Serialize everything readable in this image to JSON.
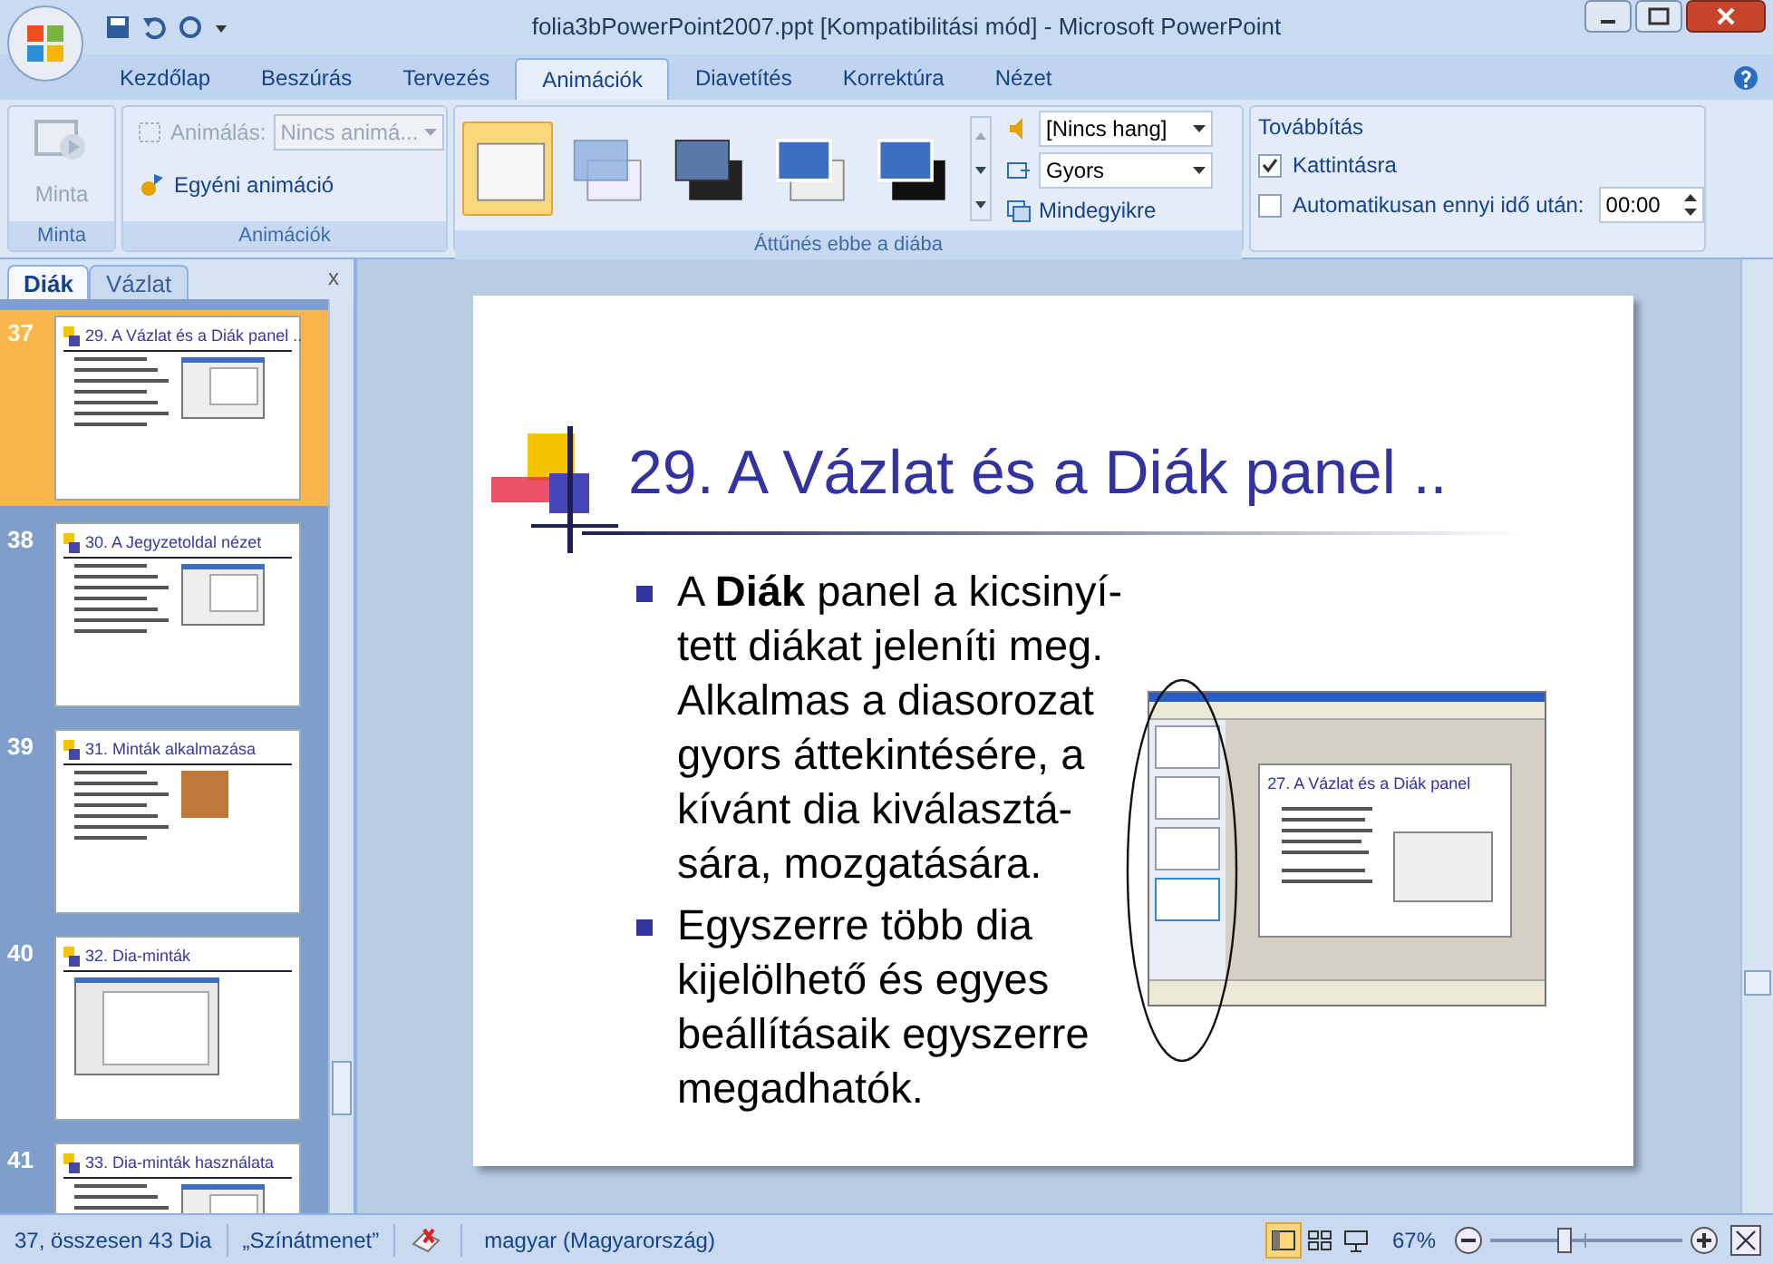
{
  "window": {
    "title": "folia3bPowerPoint2007.ppt [Kompatibilitási mód] - Microsoft PowerPoint"
  },
  "ribbon": {
    "tabs": [
      {
        "label": "Kezdőlap",
        "selected": false
      },
      {
        "label": "Beszúrás",
        "selected": false
      },
      {
        "label": "Tervezés",
        "selected": false
      },
      {
        "label": "Animációk",
        "selected": true
      },
      {
        "label": "Diavetítés",
        "selected": false
      },
      {
        "label": "Korrektúra",
        "selected": false
      },
      {
        "label": "Nézet",
        "selected": false
      }
    ],
    "preview": {
      "label": "Minta",
      "disabled": true,
      "group": "Minta"
    },
    "animations": {
      "label": "Animálás:",
      "value": "Nincs animá...",
      "disabled": true,
      "custom": "Egyéni animáció",
      "group": "Animációk"
    },
    "transitions": {
      "gallery": [
        {
          "selected": true
        },
        {
          "selected": false
        },
        {
          "selected": false
        },
        {
          "selected": false
        },
        {
          "selected": false
        }
      ],
      "sound": "[Nincs hang]",
      "speed": "Gyors",
      "apply_all": "Mindegyikre",
      "group": "Áttűnés ebbe a diába"
    },
    "advance": {
      "title": "Továbbítás",
      "options": [
        {
          "label": "Kattintásra",
          "checked": true
        },
        {
          "label": "Automatikusan ennyi idő után:",
          "checked": false
        }
      ],
      "time": "00:00"
    }
  },
  "panel": {
    "tabs": [
      {
        "label": "Diák",
        "selected": true
      },
      {
        "label": "Vázlat",
        "selected": false
      }
    ],
    "close": "x",
    "slides": [
      {
        "number": "37",
        "title": "29. A Vázlat és a Diák panel ..",
        "selected": true,
        "kind": "text-image"
      },
      {
        "number": "38",
        "title": "30. A Jegyzetoldal nézet",
        "selected": false,
        "kind": "text-image"
      },
      {
        "number": "39",
        "title": "31. Minták alkalmazása",
        "selected": false,
        "kind": "text-photo"
      },
      {
        "number": "40",
        "title": "32. Dia-minták",
        "selected": false,
        "kind": "image"
      },
      {
        "number": "41",
        "title": "33. Dia-minták használata",
        "selected": false,
        "kind": "text-image"
      }
    ]
  },
  "slide": {
    "title": "29. A Vázlat és a Diák panel ..",
    "bullets": [
      {
        "lines": [
          "A **Diák** panel a kicsinyí-",
          "tett diákat jeleníti meg.",
          "Alkalmas a diasorozat",
          "gyors áttekintésére, a",
          "kívánt dia kiválasztá-",
          "sára, mozgatására."
        ]
      },
      {
        "lines": [
          "Egyszerre több dia",
          "kijelölhető és egyes",
          "beállításaik egyszerre",
          "megadhatók."
        ]
      }
    ],
    "screenshot": {
      "title": "27. A Vázlat és a Diák panel"
    }
  },
  "status_bar": {
    "position": "37, összesen 43 Dia",
    "theme": "„Színátmenet”",
    "language": "magyar (Magyarország)",
    "views": [
      {
        "selected": true
      },
      {
        "selected": false
      },
      {
        "selected": false
      }
    ],
    "zoom": "67%",
    "zoom_slider": {
      "level": 0.38
    }
  }
}
